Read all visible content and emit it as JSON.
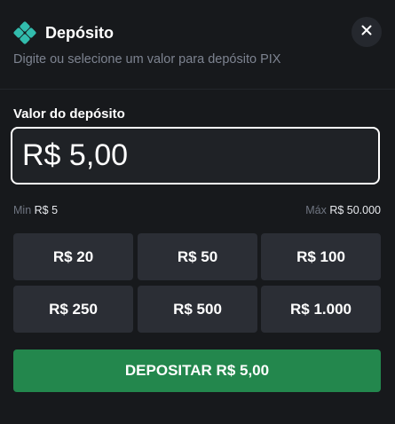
{
  "header": {
    "logo_icon": "pix-diamond-icon",
    "title": "Depósito",
    "subtitle": "Digite ou selecione um valor para depósito PIX",
    "close_icon": "close-icon"
  },
  "amount": {
    "label": "Valor do depósito",
    "value": "R$ 5,00"
  },
  "limits": {
    "min_label": "Min",
    "min_value": "R$ 5",
    "max_label": "Máx",
    "max_value": "R$ 50.000"
  },
  "presets": [
    {
      "label": "R$ 20"
    },
    {
      "label": "R$ 50"
    },
    {
      "label": "R$ 100"
    },
    {
      "label": "R$ 250"
    },
    {
      "label": "R$ 500"
    },
    {
      "label": "R$ 1.000"
    }
  ],
  "submit": {
    "label": "DEPOSITAR R$ 5,00"
  },
  "colors": {
    "background": "#17191c",
    "accent_green": "#23874d",
    "pix_teal": "#32bcad",
    "preset_bg": "#2b2e35"
  }
}
